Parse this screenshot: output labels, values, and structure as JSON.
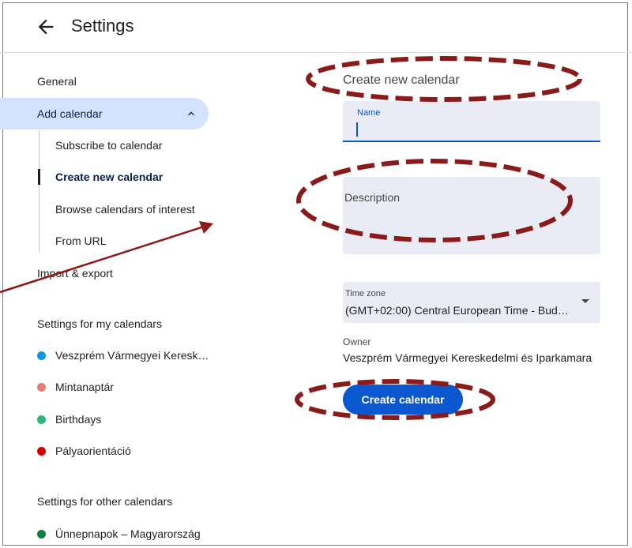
{
  "header": {
    "title": "Settings",
    "back_icon": "arrow-back-icon"
  },
  "sidebar": {
    "general": "General",
    "add_calendar": "Add calendar",
    "sub_items": [
      "Subscribe to calendar",
      "Create new calendar",
      "Browse calendars of interest",
      "From URL"
    ],
    "import_export": "Import & export",
    "my_calendars_heading": "Settings for my calendars",
    "my_calendars": [
      {
        "label": "Veszprém Vármegyei Keresk…",
        "color": "#039be5"
      },
      {
        "label": "Mintanaptár",
        "color": "#e67c73"
      },
      {
        "label": "Birthdays",
        "color": "#33b679"
      },
      {
        "label": "Pályaorientáció",
        "color": "#d50000"
      }
    ],
    "other_calendars_heading": "Settings for other calendars",
    "other_calendars": [
      {
        "label": "Ünnepnapok – Magyarország",
        "color": "#0b8043"
      }
    ]
  },
  "form": {
    "heading": "Create new calendar",
    "name_label": "Name",
    "name_value": "",
    "description_placeholder": "Description",
    "timezone_label": "Time zone",
    "timezone_value": "(GMT+02:00) Central European Time - Bud…",
    "owner_label": "Owner",
    "owner_value": "Veszprém Vármegyei Kereskedelmi és Iparkamara",
    "create_button": "Create calendar"
  },
  "colors": {
    "accent": "#0b57d0",
    "selected_bg": "#d3e3fd",
    "annotation": "#8b1a1a"
  }
}
